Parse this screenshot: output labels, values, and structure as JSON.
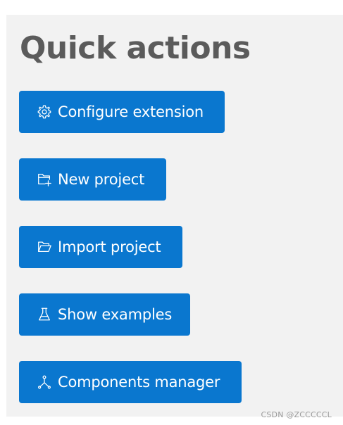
{
  "panel": {
    "title": "Quick actions"
  },
  "actions": [
    {
      "label": "Configure extension",
      "icon": "gear-icon"
    },
    {
      "label": "New project",
      "icon": "folder-plus-icon"
    },
    {
      "label": "Import project",
      "icon": "folder-open-icon"
    },
    {
      "label": "Show examples",
      "icon": "flask-icon"
    },
    {
      "label": "Components manager",
      "icon": "network-icon"
    }
  ],
  "watermark": "CSDN @ZCCCCCL",
  "colors": {
    "panel_bg": "#f2f2f2",
    "button_bg": "#0a77cf",
    "button_text": "#ffffff",
    "title_text": "#5b5b5b",
    "watermark_text": "#9a9a9a"
  }
}
